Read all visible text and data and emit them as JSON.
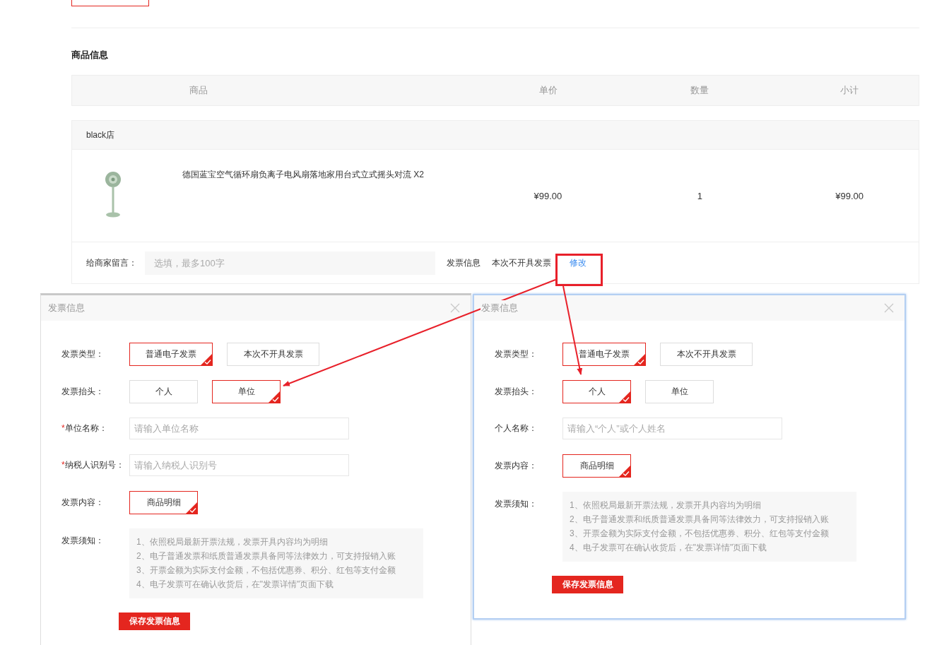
{
  "section_title": "商品信息",
  "table": {
    "columns": [
      "商品",
      "单价",
      "数量",
      "小计"
    ],
    "shop": "black店",
    "rows": [
      {
        "name": "德国蓝宝空气循环扇负离子电风扇落地家用台式立式摇头对流 X2",
        "price": "¥99.00",
        "quantity": "1",
        "subtotal": "¥99.00"
      }
    ]
  },
  "message": {
    "label": "给商家留言：",
    "placeholder": "选填，最多100字"
  },
  "invoice": {
    "label": "发票信息",
    "value": "本次不开具发票",
    "edit_link": "修改"
  },
  "dialogs": [
    {
      "title": "发票信息",
      "fields": [
        {
          "kind": "options",
          "label": "发票类型：",
          "options": [
            {
              "label": "普通电子发票",
              "selected": true
            },
            {
              "label": "本次不开具发票",
              "selected": false
            }
          ]
        },
        {
          "kind": "options",
          "label": "发票抬头：",
          "options": [
            {
              "label": "个人",
              "selected": false
            },
            {
              "label": "单位",
              "selected": true
            }
          ]
        },
        {
          "kind": "input",
          "label": "单位名称：",
          "required_mark": "*",
          "placeholder": "请输入单位名称"
        },
        {
          "kind": "input",
          "label": "纳税人识别号：",
          "required_mark": "*",
          "placeholder": "请输入纳税人识别号"
        },
        {
          "kind": "options",
          "label": "发票内容：",
          "options": [
            {
              "label": "商品明细",
              "selected": true
            }
          ]
        },
        {
          "kind": "notice",
          "label": "发票须知：",
          "lines": [
            "1、依照税局最新开票法规，发票开具内容均为明细",
            "2、电子普通发票和纸质普通发票具备同等法律效力，可支持报销入账",
            "3、开票金额为实际支付金额，不包括优惠券、积分、红包等支付金额",
            "4、电子发票可在确认收货后，在\"发票详情\"页面下载"
          ]
        }
      ],
      "save_button": "保存发票信息"
    },
    {
      "title": "发票信息",
      "fields": [
        {
          "kind": "options",
          "label": "发票类型：",
          "options": [
            {
              "label": "普通电子发票",
              "selected": true
            },
            {
              "label": "本次不开具发票",
              "selected": false
            }
          ]
        },
        {
          "kind": "options",
          "label": "发票抬头：",
          "options": [
            {
              "label": "个人",
              "selected": true
            },
            {
              "label": "单位",
              "selected": false
            }
          ]
        },
        {
          "kind": "input",
          "label": "个人名称：",
          "placeholder": "请输入“个人”或个人姓名"
        },
        {
          "kind": "options",
          "label": "发票内容：",
          "options": [
            {
              "label": "商品明细",
              "selected": true
            }
          ]
        },
        {
          "kind": "notice",
          "label": "发票须知：",
          "lines": [
            "1、依照税局最新开票法规，发票开具内容均为明细",
            "2、电子普通发票和纸质普通发票具备同等法律效力，可支持报销入账",
            "3、开票金额为实际支付金额，不包括优惠券、积分、红包等支付金额",
            "4、电子发票可在确认收货后，在\"发票详情\"页面下载"
          ]
        }
      ],
      "save_button": "保存发票信息"
    }
  ]
}
